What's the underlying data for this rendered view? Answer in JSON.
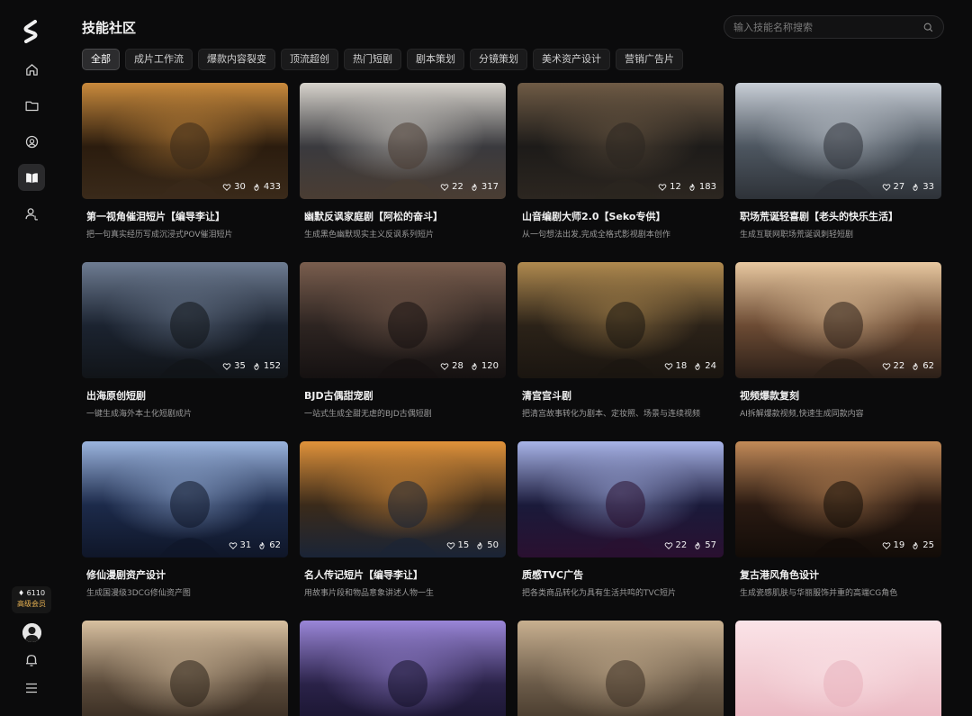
{
  "app": {
    "brand_letter": "S"
  },
  "sidebar": {
    "items": [
      {
        "name": "home-icon"
      },
      {
        "name": "folder-icon"
      },
      {
        "name": "compass-icon"
      },
      {
        "name": "book-icon",
        "active": true
      },
      {
        "name": "user-icon"
      }
    ],
    "credits": "♦ 6110",
    "membership": "高级会员"
  },
  "header": {
    "title": "技能社区",
    "search_placeholder": "输入技能名称搜索"
  },
  "tabs": [
    "全部",
    "成片工作流",
    "爆款内容裂变",
    "顶流超创",
    "热门短剧",
    "剧本策划",
    "分镜策划",
    "美术资产设计",
    "营销广告片"
  ],
  "active_tab": 0,
  "cards": [
    {
      "title": "第一视角催泪短片【编导李让】",
      "desc": "把一句真实经历写成沉浸式POV催泪短片",
      "likes": "30",
      "uses": "433"
    },
    {
      "title": "幽默反讽家庭剧【阿松的奋斗】",
      "desc": "生成黑色幽默现实主义反讽系列短片",
      "likes": "22",
      "uses": "317"
    },
    {
      "title": "山音编剧大师2.0【Seko专供】",
      "desc": "从一句想法出发,完成全格式影视剧本创作",
      "likes": "12",
      "uses": "183"
    },
    {
      "title": "职场荒诞轻喜剧【老头的快乐生活】",
      "desc": "生成互联网职场荒诞讽刺轻短剧",
      "likes": "27",
      "uses": "33"
    },
    {
      "title": "出海原创短剧",
      "desc": "一键生成海外本土化短剧成片",
      "likes": "35",
      "uses": "152"
    },
    {
      "title": "BJD古偶甜宠剧",
      "desc": "一站式生成全甜无虐的BJD古偶短剧",
      "likes": "28",
      "uses": "120"
    },
    {
      "title": "清宫宫斗剧",
      "desc": "把清宫故事转化为剧本、定妆照、场景与连续视频",
      "likes": "18",
      "uses": "24"
    },
    {
      "title": "视频爆款复刻",
      "desc": "AI拆解爆款视频,快速生成同款内容",
      "likes": "22",
      "uses": "62"
    },
    {
      "title": "修仙漫剧资产设计",
      "desc": "生成国漫级3DCG修仙资产图",
      "likes": "31",
      "uses": "62"
    },
    {
      "title": "名人传记短片【编导李让】",
      "desc": "用故事片段和物品意象讲述人物一生",
      "likes": "15",
      "uses": "50"
    },
    {
      "title": "质感TVC广告",
      "desc": "把各类商品转化为具有生活共鸣的TVC短片",
      "likes": "22",
      "uses": "57"
    },
    {
      "title": "复古港风角色设计",
      "desc": "生成瓷感肌肤与华丽服饰并重的高端CG角色",
      "likes": "19",
      "uses": "25"
    },
    {
      "title": "",
      "desc": "",
      "likes": "",
      "uses": ""
    },
    {
      "title": "",
      "desc": "",
      "likes": "",
      "uses": ""
    },
    {
      "title": "",
      "desc": "",
      "likes": "",
      "uses": ""
    },
    {
      "title": "",
      "desc": "",
      "likes": "",
      "uses": ""
    }
  ],
  "colors": {
    "accent": "#e9b353",
    "background": "#0b0b0c",
    "tab_bg": "#1a1a1b"
  }
}
